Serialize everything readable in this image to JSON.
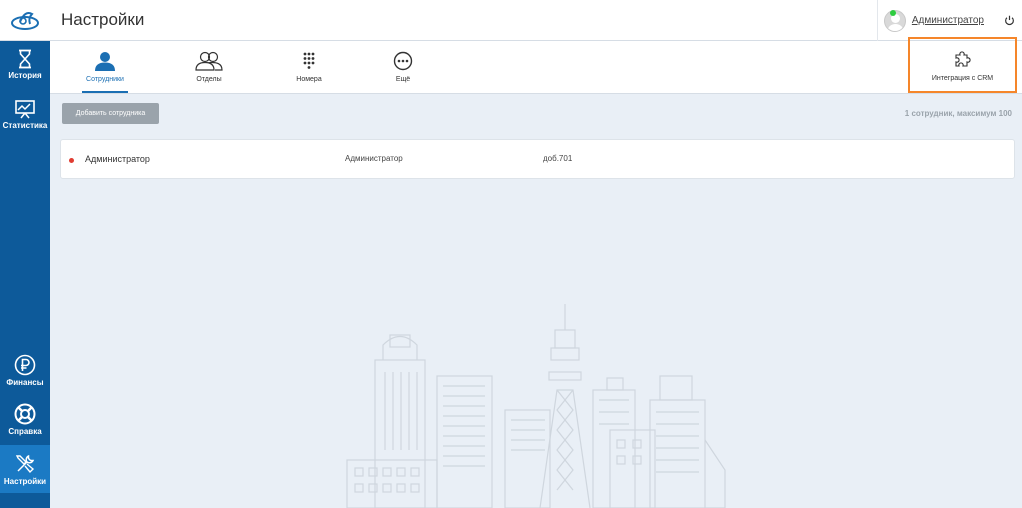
{
  "header": {
    "title": "Настройки",
    "user_name": "Администратор"
  },
  "sidebar": {
    "items": [
      {
        "label": "История",
        "icon": "hourglass-icon"
      },
      {
        "label": "Статистика",
        "icon": "chart-icon"
      },
      {
        "label": "Финансы",
        "icon": "ruble-icon"
      },
      {
        "label": "Справка",
        "icon": "lifebuoy-icon"
      },
      {
        "label": "Настройки",
        "icon": "tools-icon",
        "active": true
      }
    ]
  },
  "tabs": {
    "items": [
      {
        "label": "Сотрудники",
        "icon": "user-icon",
        "active": true
      },
      {
        "label": "Отделы",
        "icon": "users-icon"
      },
      {
        "label": "Номера",
        "icon": "keypad-icon"
      },
      {
        "label": "Ещё",
        "icon": "more-icon"
      }
    ],
    "crm_label": "Интеграция с CRM"
  },
  "content": {
    "add_button_label": "Добавить сотрудника",
    "count_text": "1 сотрудник, максимум 100",
    "employees": [
      {
        "name": "Администратор",
        "department": "Администратор",
        "extension": "доб.701",
        "status_color": "#e03c31"
      }
    ]
  },
  "colors": {
    "sidebar": "#0d5a9a",
    "sidebar_active": "#1b7ac4",
    "accent": "#1b6fb3",
    "highlight": "#f5862a"
  }
}
